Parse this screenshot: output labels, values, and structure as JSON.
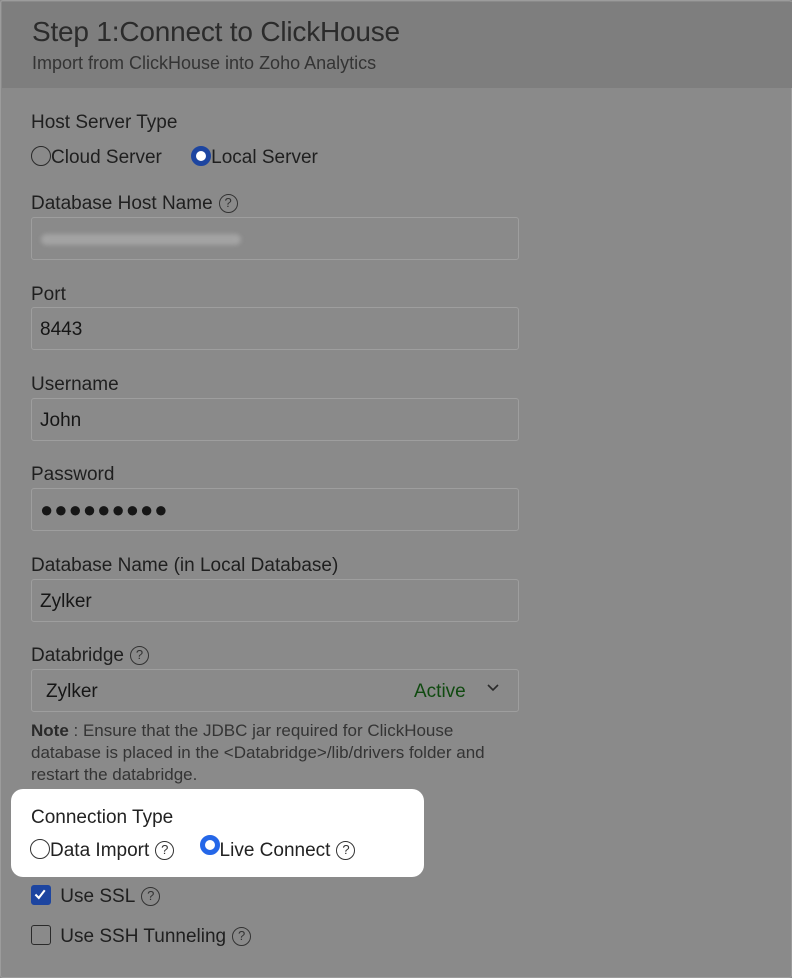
{
  "header": {
    "title": "Step 1:Connect to ClickHouse",
    "subtitle": "Import from ClickHouse into Zoho Analytics"
  },
  "host_server_type": {
    "label": "Host Server Type",
    "options": [
      {
        "label": "Cloud Server",
        "selected": false
      },
      {
        "label": "Local Server",
        "selected": true
      }
    ]
  },
  "database_host": {
    "label": "Database Host Name",
    "help_glyph": "?"
  },
  "port": {
    "label": "Port",
    "value": "8443"
  },
  "username": {
    "label": "Username",
    "value": "John"
  },
  "password": {
    "label": "Password",
    "value": "●●●●●●●●●"
  },
  "database_name": {
    "label": "Database Name (in Local Database)",
    "value": "Zylker"
  },
  "databridge": {
    "label": "Databridge",
    "help_glyph": "?",
    "selected": "Zylker",
    "status": "Active",
    "status_color": "#104a10"
  },
  "note": {
    "prefix": "Note",
    "text": " : Ensure that the JDBC jar required for ClickHouse database is placed in the <Databridge>/lib/drivers folder and restart the databridge."
  },
  "connection_type": {
    "label": "Connection Type",
    "options": [
      {
        "label": "Data Import",
        "selected": false,
        "help_glyph": "?"
      },
      {
        "label": "Live Connect",
        "selected": true,
        "help_glyph": "?"
      }
    ]
  },
  "use_ssl": {
    "label": "Use SSL",
    "checked": true,
    "help_glyph": "?"
  },
  "use_ssh": {
    "label": "Use SSH Tunneling",
    "checked": false,
    "help_glyph": "?"
  },
  "colors": {
    "overlay": "#8a8a8a",
    "accent_dim": "#1d45a0",
    "accent": "#2567e8",
    "popup_bg": "#ffffff"
  }
}
